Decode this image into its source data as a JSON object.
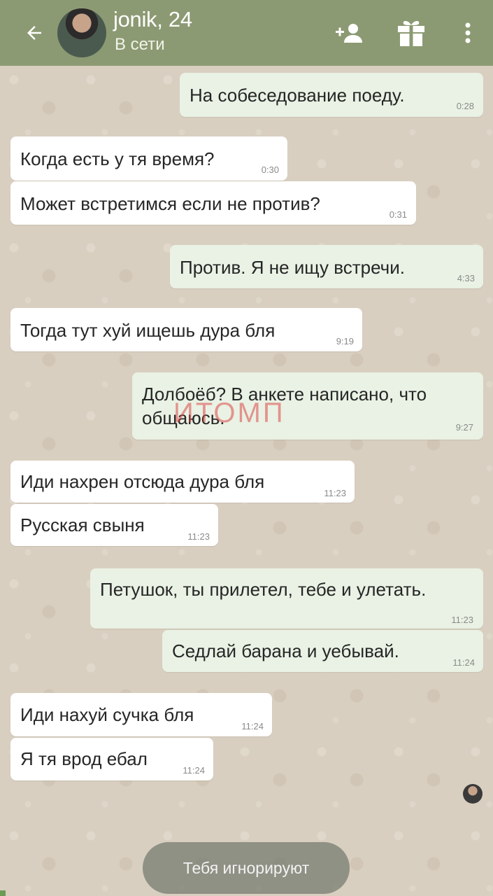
{
  "header": {
    "contact_name": "jonik, 24",
    "status": "В сети",
    "icons": {
      "back": "back-arrow-icon",
      "add_friend": "add-person-icon",
      "gift": "gift-icon",
      "more": "more-vertical-icon"
    },
    "background_color": "#8c9a73"
  },
  "messages": [
    {
      "direction": "out",
      "text": "На собеседование поеду.",
      "time": "0:28"
    },
    {
      "direction": "in",
      "text": "Когда есть у тя время?",
      "time": "0:30"
    },
    {
      "direction": "in",
      "text": "Может встретимся если не против?",
      "time": "0:31"
    },
    {
      "direction": "out",
      "text": "Против. Я не ищу встречи.",
      "time": "4:33"
    },
    {
      "direction": "in",
      "text": "Тогда  тут хуй ищешь дура бля",
      "time": "9:19"
    },
    {
      "direction": "out",
      "text_line1": "Долбоёб? В анкете написано, что",
      "text_line2": "общаюсь.",
      "time": "9:27"
    },
    {
      "direction": "in",
      "text": "Иди нахрен отсюда дура бля",
      "time": "11:23"
    },
    {
      "direction": "in",
      "text": "Русская свыня",
      "time": "11:23"
    },
    {
      "direction": "out",
      "text": "Петушок, ты прилетел, тебе и улетать.",
      "time": "11:23"
    },
    {
      "direction": "out",
      "text": "Седлай барана и уебывай.",
      "time": "11:24"
    },
    {
      "direction": "in",
      "text": "Иди нахуй сучка бля",
      "time": "11:24"
    },
    {
      "direction": "in",
      "text": "Я тя врод ебал",
      "time": "11:24"
    }
  ],
  "watermark": "ИТОМП",
  "footer": {
    "ignore_notice": "Тебя игнорируют"
  },
  "colors": {
    "chat_background": "#d9cfc0",
    "incoming_bubble": "#ffffff",
    "outgoing_bubble": "#e9f2e4"
  }
}
